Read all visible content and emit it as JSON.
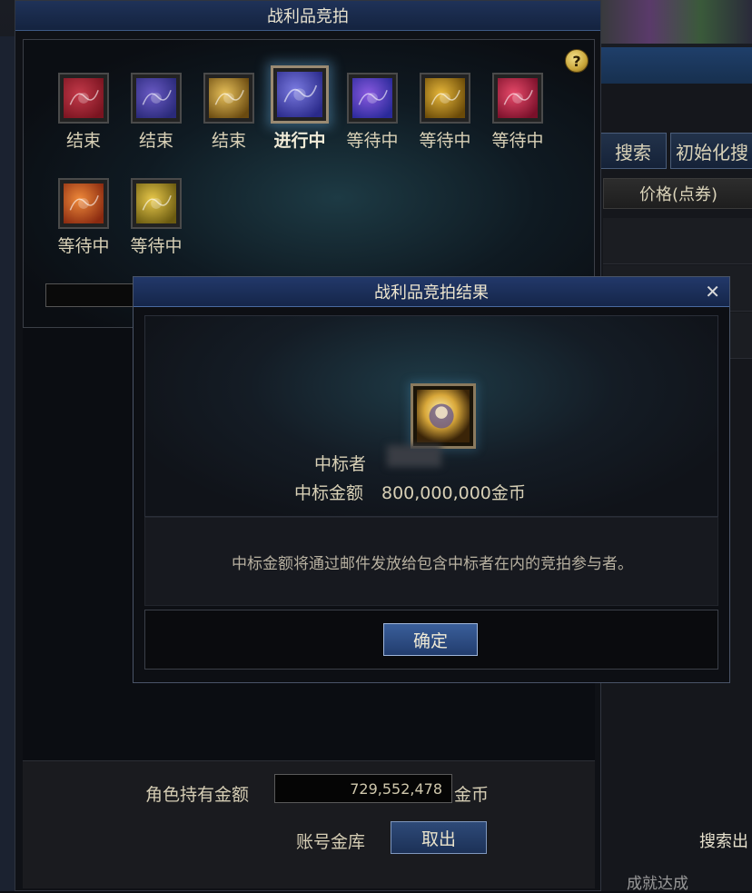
{
  "window_title": "战利品竞拍",
  "help_symbol": "?",
  "items": [
    {
      "status": "结束",
      "color_a": "#7a1420",
      "color_b": "#c43a4a"
    },
    {
      "status": "结束",
      "color_a": "#2a2a7a",
      "color_b": "#6a5ac4"
    },
    {
      "status": "结束",
      "color_a": "#6a4a10",
      "color_b": "#e8c15a"
    },
    {
      "status": "进行中",
      "color_a": "#2a2a8a",
      "color_b": "#7a7ae0",
      "active": true
    },
    {
      "status": "等待中",
      "color_a": "#2a2a9a",
      "color_b": "#8a5ae0"
    },
    {
      "status": "等待中",
      "color_a": "#6a4a08",
      "color_b": "#e8b83a"
    },
    {
      "status": "等待中",
      "color_a": "#7a102a",
      "color_b": "#e84a6a"
    },
    {
      "status": "等待中",
      "color_a": "#8a2a10",
      "color_b": "#f08a3a"
    },
    {
      "status": "等待中",
      "color_a": "#6a5a10",
      "color_b": "#e8c84a"
    }
  ],
  "balance": {
    "label": "角色持有金额",
    "value": "729,552,478",
    "unit": "金币"
  },
  "vault": {
    "label": "账号金库",
    "button": "取出"
  },
  "dialog": {
    "title": "战利品竞拍结果",
    "close": "✕",
    "winner_label": "中标者",
    "amount_label": "中标金额",
    "amount_value": "800,000,000金币",
    "notice": "中标金额将通过邮件发放给包含中标者在内的竞拍参与者。",
    "ok_button": "确定"
  },
  "background": {
    "search_button": "搜索",
    "init_button": "初始化搜",
    "price_header": "价格(点券)",
    "search_partial": "搜索出",
    "footer_text": "成就达成"
  }
}
